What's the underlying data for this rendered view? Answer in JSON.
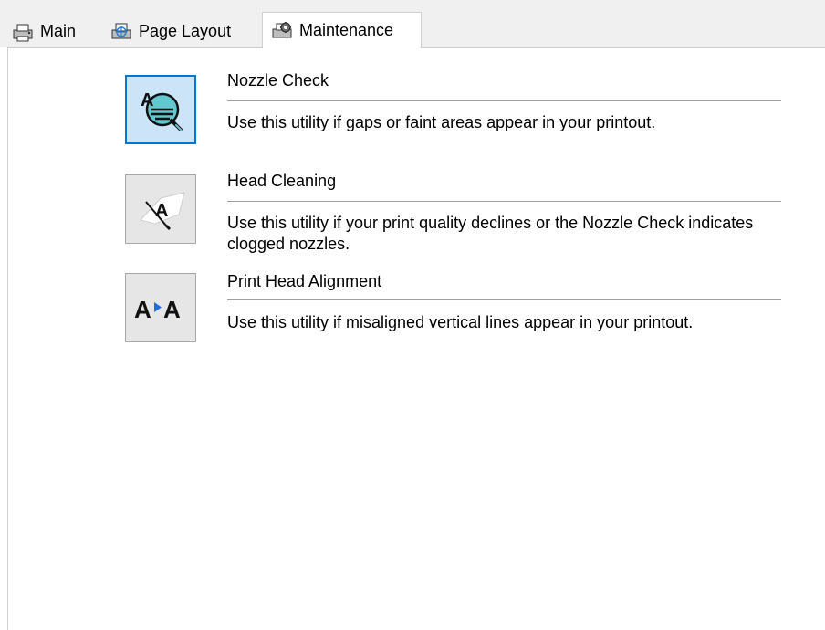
{
  "tabs": [
    {
      "label": "Main",
      "icon": "printer-main-icon"
    },
    {
      "label": "Page Layout",
      "icon": "page-layout-icon"
    },
    {
      "label": "Maintenance",
      "icon": "maintenance-icon",
      "active": true
    }
  ],
  "utilities": [
    {
      "title": "Nozzle Check",
      "description": "Use this utility if gaps or faint areas appear in your printout.",
      "icon": "nozzle-check-icon",
      "selected": true
    },
    {
      "title": "Head Cleaning",
      "description": "Use this utility if your print quality declines or the Nozzle Check indicates clogged nozzles.",
      "icon": "head-cleaning-icon",
      "selected": false
    },
    {
      "title": "Print Head Alignment",
      "description": "Use this utility if misaligned vertical lines appear in your printout.",
      "icon": "print-head-alignment-icon",
      "selected": false
    }
  ],
  "colors": {
    "selection_border": "#0078d7",
    "selection_fill": "#cce4f7",
    "alignment_arrow": "#1e6fd9"
  }
}
